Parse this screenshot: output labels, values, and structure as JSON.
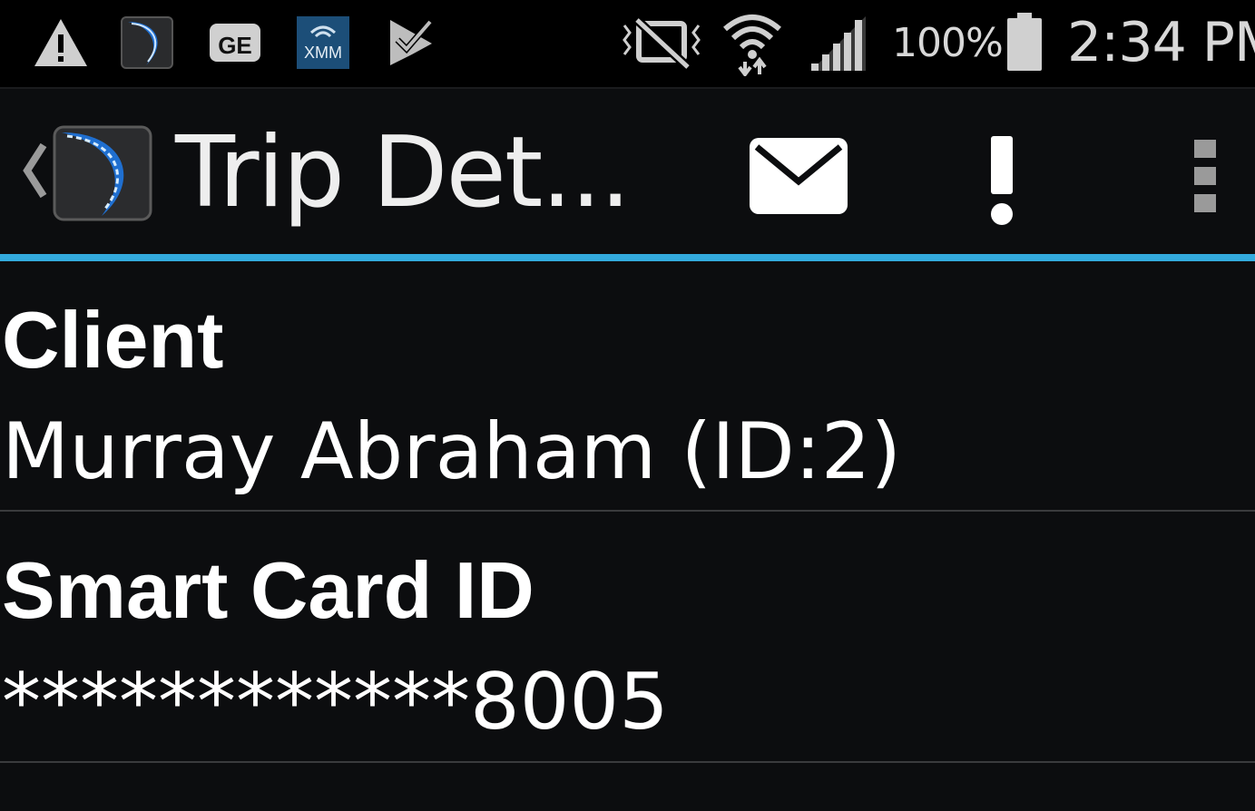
{
  "status_bar": {
    "battery_text": "100%",
    "time": "2:34 PM",
    "icons": [
      "warning-icon",
      "app-logo-icon",
      "ge-icon",
      "xmm-icon",
      "task-check-icon",
      "vibrate-mute-icon",
      "wifi-icon",
      "signal-icon",
      "battery-icon"
    ],
    "ge_label": "GE",
    "xmm_label": "XMM"
  },
  "action_bar": {
    "title": "Trip Det...",
    "actions": [
      "email-icon",
      "alert-icon",
      "overflow-menu-icon"
    ]
  },
  "colors": {
    "accent": "#33aadd",
    "background": "#0c0d0f",
    "status_bar": "#000000"
  },
  "details": [
    {
      "label": "Client",
      "value": "Murray Abraham (ID:2)"
    },
    {
      "label": "Smart Card ID",
      "value": "************8005"
    }
  ]
}
